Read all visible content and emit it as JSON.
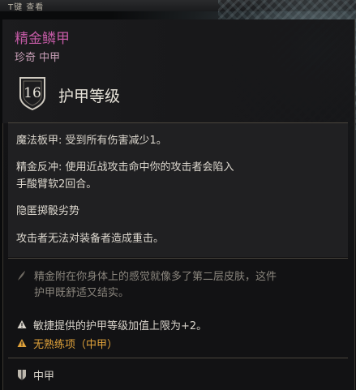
{
  "hotkey_hint": "T键 查看",
  "item": {
    "name": "精金鳞甲",
    "subtitle": "珍奇 中甲",
    "armor_class_value": "16",
    "armor_class_label": "护甲等级"
  },
  "properties": [
    "魔法板甲: 受到所有伤害减少1。",
    "精金反冲: 使用近战攻击命中你的攻击者会陷入",
    "手酸臂软2回合。",
    "隐匿掷骰劣势",
    "攻击者无法对装备者造成重击。"
  ],
  "flavor_text_line1": "精金附在你身体上的感觉就像多了第二层皮肤，这件",
  "flavor_text_line2": "护甲既舒适又结实。",
  "warnings": {
    "dex_cap": "敏捷提供的护甲等级加值上限为+2。",
    "proficiency": "无熟练项（中甲）"
  },
  "footer": {
    "armor_type": "中甲"
  },
  "colors": {
    "rarity_name": "#c25aa4",
    "rarity_sub": "#c9a0b8",
    "warning_orange": "#e0a23a"
  }
}
